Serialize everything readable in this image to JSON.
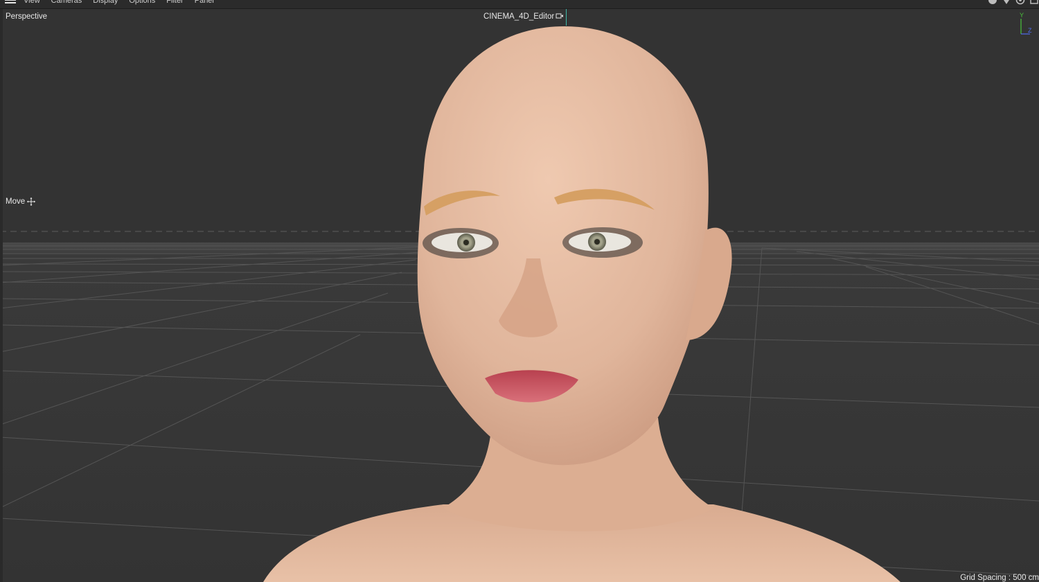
{
  "menu": {
    "items": [
      "View",
      "Cameras",
      "Display",
      "Options",
      "Filter",
      "Panel"
    ],
    "icons": [
      "hamburger-menu-icon",
      "pan-view-icon",
      "dolly-view-icon",
      "rotate-view-icon",
      "toggle-panel-icon"
    ]
  },
  "viewport": {
    "view_name": "Perspective",
    "camera_name": "CINEMA_4D_Editor",
    "camera_icon": "camera-icon",
    "tool_name": "Move",
    "tool_icon": "move-cross-icon",
    "grid_spacing": "Grid Spacing : 500 cm",
    "axis_labels": {
      "y": "Y",
      "z": "Z"
    }
  },
  "colors": {
    "viewport_bg": "#333333",
    "grid_line": "#5a5a5a",
    "axis_y": "#49c43a",
    "axis_z": "#4f6cf0",
    "skin": "#e0b59b",
    "lips": "#c9525d",
    "brows": "#d9a066",
    "camera_marker": "#3fb8a8"
  }
}
